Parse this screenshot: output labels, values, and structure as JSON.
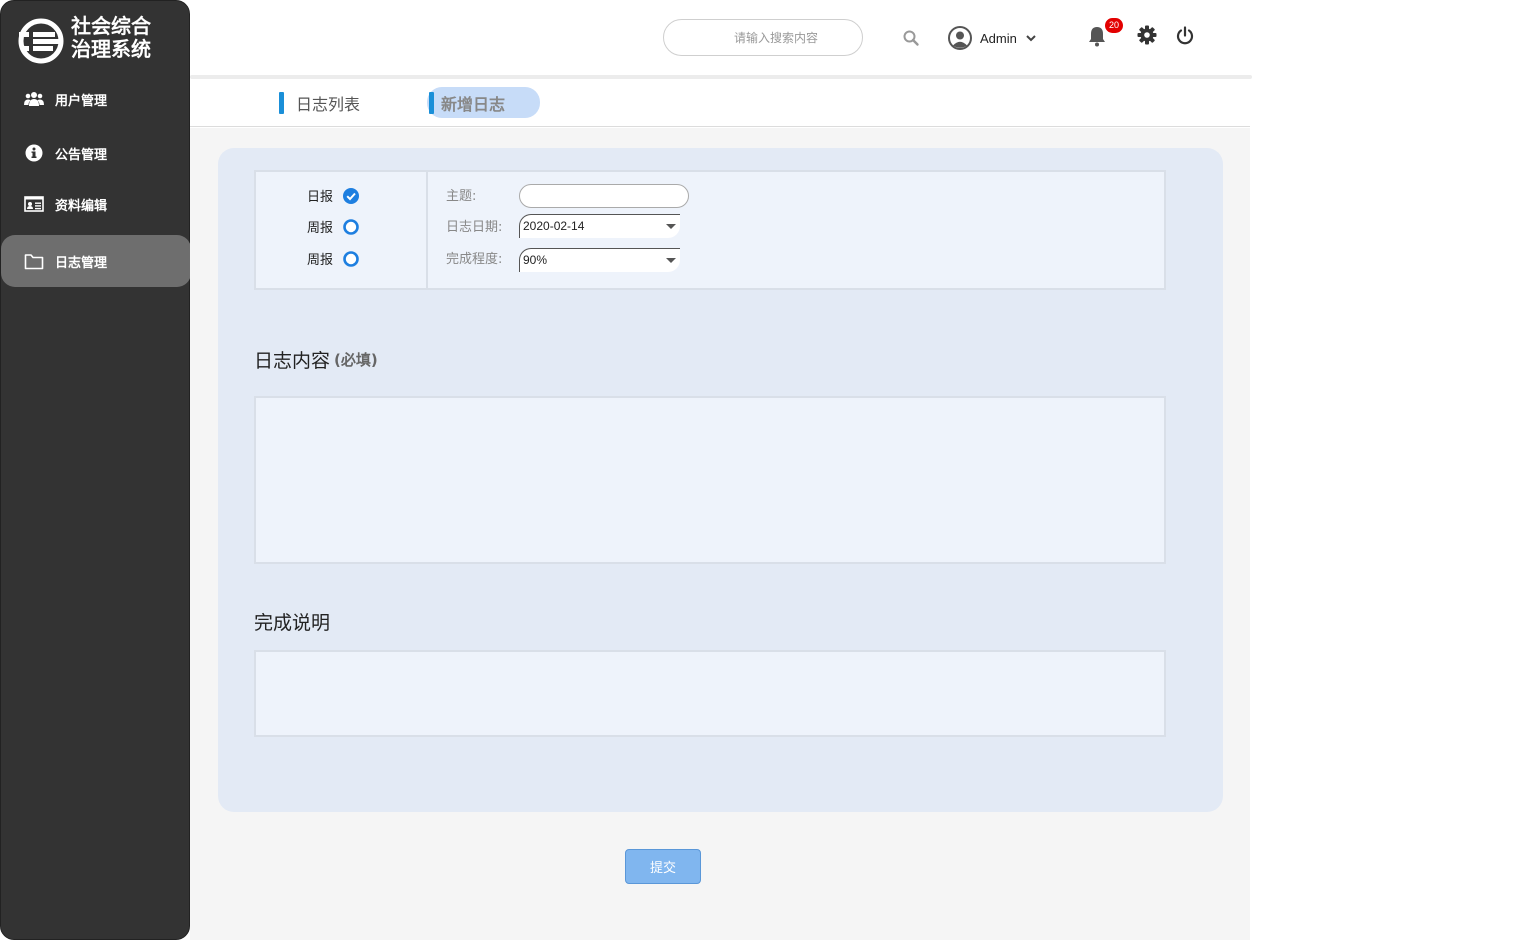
{
  "app": {
    "logo_line1": "社会综合",
    "logo_line2": "治理系统"
  },
  "sidebar": {
    "items": [
      {
        "label": "用户管理",
        "icon": "users-icon"
      },
      {
        "label": "公告管理",
        "icon": "info-icon"
      },
      {
        "label": "资料编辑",
        "icon": "id-card-icon"
      },
      {
        "label": "日志管理",
        "icon": "folder-icon",
        "active": true
      }
    ]
  },
  "header": {
    "search_placeholder": "请输入搜索内容",
    "username": "Admin",
    "notification_count": "20"
  },
  "tabs": [
    {
      "label": "日志列表",
      "active": false
    },
    {
      "label": "新增日志",
      "active": true
    }
  ],
  "form": {
    "report_types": [
      {
        "label": "日报",
        "checked": true
      },
      {
        "label": "周报",
        "checked": false
      },
      {
        "label": "周报",
        "checked": false
      }
    ],
    "subject_label": "主题:",
    "subject_value": "",
    "date_label": "日志日期:",
    "date_value": "2020-02-14",
    "progress_label": "完成程度:",
    "progress_value": "90%",
    "content_title": "日志内容",
    "content_required": "(必填)",
    "content_value": "",
    "completion_title": "完成说明",
    "completion_value": "",
    "submit_label": "提交"
  },
  "colors": {
    "sidebar_bg": "#333333",
    "accent_blue": "#1a8fd8",
    "badge_red": "#e30000",
    "submit_bg": "#80b6ef"
  }
}
